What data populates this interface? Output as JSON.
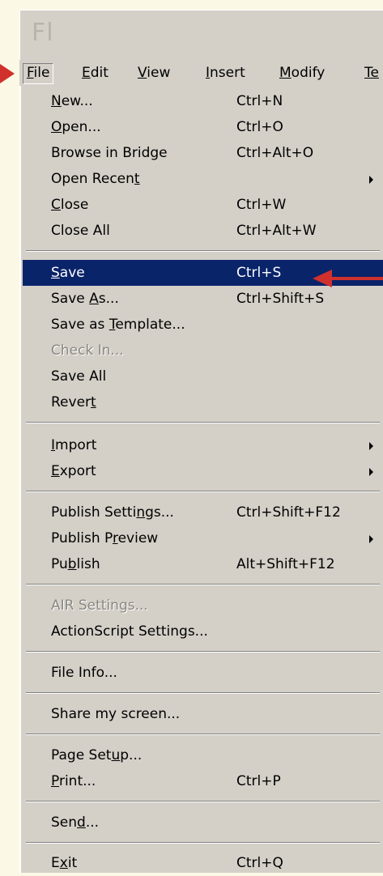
{
  "app": {
    "logo_text": "Fl"
  },
  "menubar": {
    "items": [
      {
        "pre": "",
        "u": "F",
        "post": "ile"
      },
      {
        "pre": "",
        "u": "E",
        "post": "dit"
      },
      {
        "pre": "",
        "u": "V",
        "post": "iew"
      },
      {
        "pre": "",
        "u": "I",
        "post": "nsert"
      },
      {
        "pre": "",
        "u": "M",
        "post": "odify"
      },
      {
        "pre": "",
        "u": "Te",
        "post": ""
      }
    ]
  },
  "file_menu": {
    "new": {
      "pre": "",
      "u": "N",
      "post": "ew...",
      "shortcut": "Ctrl+N"
    },
    "open": {
      "pre": "",
      "u": "O",
      "post": "pen...",
      "shortcut": "Ctrl+O"
    },
    "browse_bridge": {
      "pre": "Browse in Bridge",
      "u": "",
      "post": "",
      "shortcut": "Ctrl+Alt+O"
    },
    "open_recent": {
      "pre": "Open Recen",
      "u": "t",
      "post": "",
      "shortcut": ""
    },
    "close": {
      "pre": "",
      "u": "C",
      "post": "lose",
      "shortcut": "Ctrl+W"
    },
    "close_all": {
      "pre": "Close All",
      "u": "",
      "post": "",
      "shortcut": "Ctrl+Alt+W"
    },
    "save": {
      "pre": "",
      "u": "S",
      "post": "ave",
      "shortcut": "Ctrl+S"
    },
    "save_as": {
      "pre": "Save ",
      "u": "A",
      "post": "s...",
      "shortcut": "Ctrl+Shift+S"
    },
    "save_template": {
      "pre": "Save as ",
      "u": "T",
      "post": "emplate...",
      "shortcut": ""
    },
    "check_in": {
      "pre": "Check In...",
      "u": "",
      "post": "",
      "shortcut": ""
    },
    "save_all": {
      "pre": "Save All",
      "u": "",
      "post": "",
      "shortcut": ""
    },
    "revert": {
      "pre": "Rever",
      "u": "t",
      "post": "",
      "shortcut": ""
    },
    "import": {
      "pre": "",
      "u": "I",
      "post": "mport",
      "shortcut": ""
    },
    "export": {
      "pre": "",
      "u": "E",
      "post": "xport",
      "shortcut": ""
    },
    "publish_settings": {
      "pre": "Publish Setti",
      "u": "n",
      "post": "gs...",
      "shortcut": "Ctrl+Shift+F12"
    },
    "publish_preview": {
      "pre": "Publish P",
      "u": "r",
      "post": "eview",
      "shortcut": ""
    },
    "publish": {
      "pre": "Pu",
      "u": "b",
      "post": "lish",
      "shortcut": "Alt+Shift+F12"
    },
    "air_settings": {
      "pre": "AIR Settings...",
      "u": "",
      "post": "",
      "shortcut": ""
    },
    "actionscript_settings": {
      "pre": "ActionScript Settings...",
      "u": "",
      "post": "",
      "shortcut": ""
    },
    "file_info": {
      "pre": "File Info...",
      "u": "",
      "post": "",
      "shortcut": ""
    },
    "share_screen": {
      "pre": "Share my screen...",
      "u": "",
      "post": "",
      "shortcut": ""
    },
    "page_setup": {
      "pre": "Page Set",
      "u": "u",
      "post": "p...",
      "shortcut": ""
    },
    "print": {
      "pre": "",
      "u": "P",
      "post": "rint...",
      "shortcut": "Ctrl+P"
    },
    "send": {
      "pre": "Sen",
      "u": "d",
      "post": "...",
      "shortcut": ""
    },
    "exit": {
      "pre": "E",
      "u": "x",
      "post": "it",
      "shortcut": "Ctrl+Q"
    }
  },
  "colors": {
    "highlight": "#0a246a",
    "annotation_arrow": "#d0312d",
    "menu_bg": "#d4d0c8"
  }
}
